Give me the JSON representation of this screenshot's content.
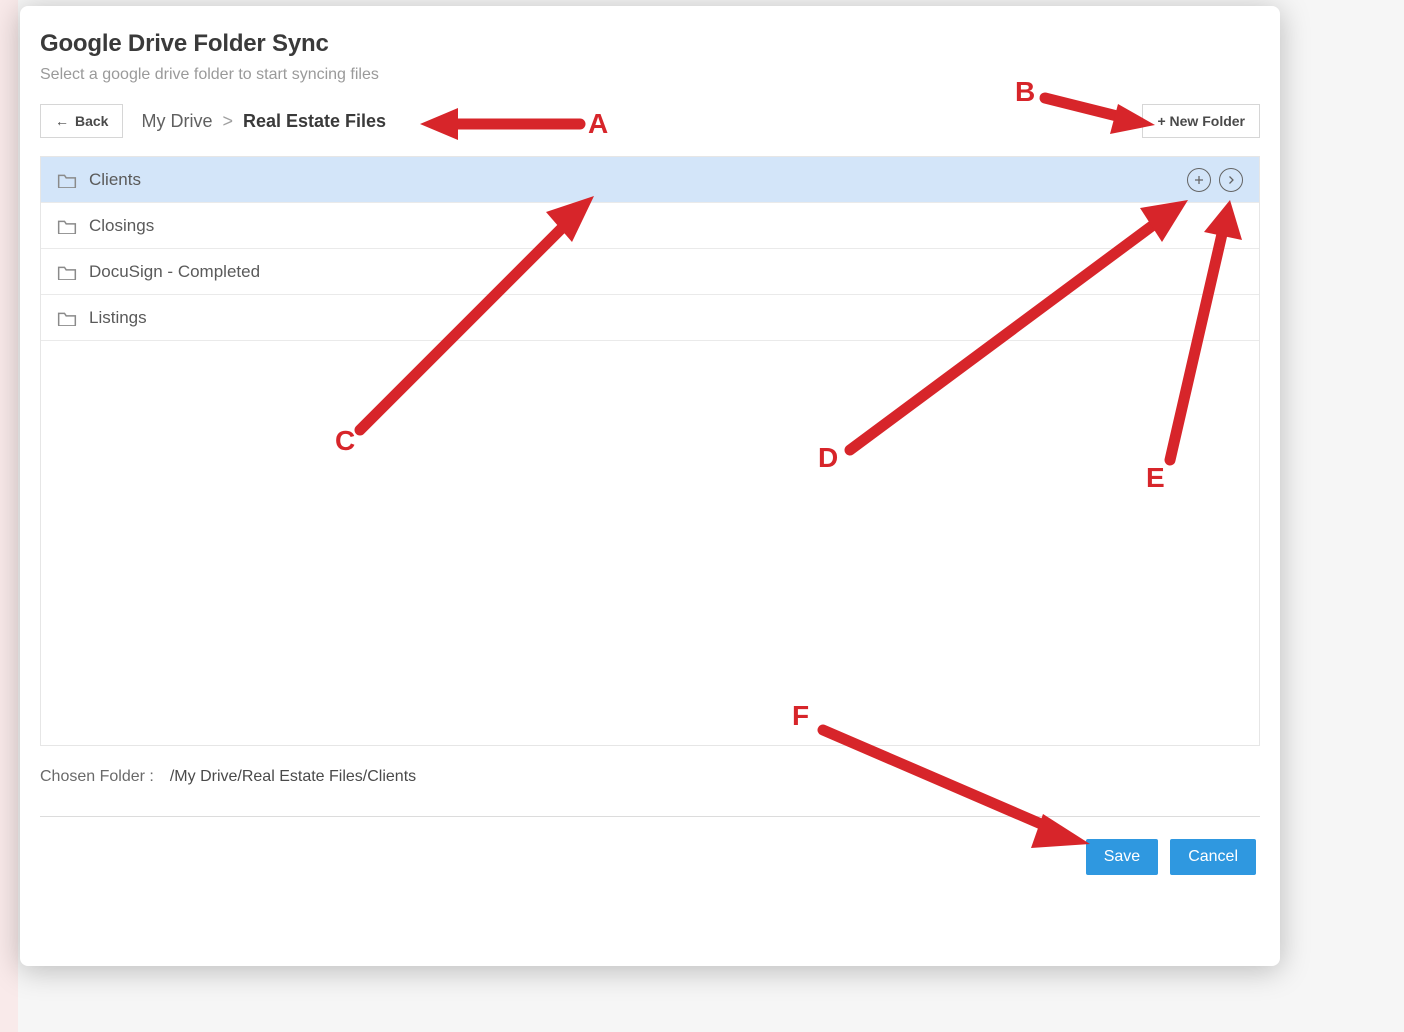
{
  "modal": {
    "title": "Google Drive Folder Sync",
    "subtitle": "Select a google drive folder to start syncing files",
    "back_label": "Back",
    "newfolder_label": "+ New Folder",
    "crumb_root": "My Drive",
    "crumb_sep": ">",
    "crumb_current": "Real Estate Files"
  },
  "folders": [
    {
      "name": "Clients",
      "selected": true
    },
    {
      "name": "Closings",
      "selected": false
    },
    {
      "name": "DocuSign - Completed",
      "selected": false
    },
    {
      "name": "Listings",
      "selected": false
    }
  ],
  "chosen": {
    "label": "Chosen Folder :",
    "path": "/My Drive/Real Estate Files/Clients"
  },
  "footer": {
    "save": "Save",
    "cancel": "Cancel"
  },
  "annotations": {
    "A": "A",
    "B": "B",
    "C": "C",
    "D": "D",
    "E": "E",
    "F": "F"
  }
}
